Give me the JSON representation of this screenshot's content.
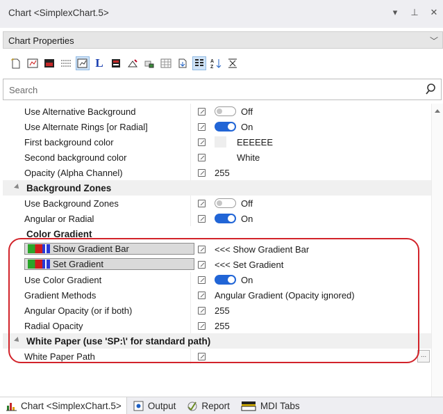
{
  "window": {
    "title": "Chart <SimplexChart.5>",
    "controls": [
      "dropdown-icon",
      "pin-icon",
      "close-icon"
    ]
  },
  "panel": {
    "header": "Chart Properties"
  },
  "search": {
    "placeholder": "Search"
  },
  "rows": [
    {
      "type": "prop",
      "label": "Use Alternative Background",
      "kind": "toggle",
      "state": "off",
      "value": "Off"
    },
    {
      "type": "prop",
      "label": "Use Alternate Rings [or Radial]",
      "kind": "toggle",
      "state": "on",
      "value": "On"
    },
    {
      "type": "prop",
      "label": "First background color",
      "kind": "color",
      "swatch": "#EEEEEE",
      "value": "EEEEEE"
    },
    {
      "type": "prop",
      "label": "Second background color",
      "kind": "color",
      "swatch": "#FFFFFF",
      "value": "White"
    },
    {
      "type": "prop",
      "label": "Opacity (Alpha Channel)",
      "kind": "text",
      "value": "255"
    },
    {
      "type": "category",
      "label": "Background Zones",
      "expanded": true
    },
    {
      "type": "prop",
      "label": "Use Background Zones",
      "kind": "toggle",
      "state": "off",
      "value": "Off"
    },
    {
      "type": "prop",
      "label": "Angular or Radial",
      "kind": "toggle",
      "state": "on",
      "value": "On"
    },
    {
      "type": "category",
      "label": "Color Gradient",
      "expanded": true
    },
    {
      "type": "prop",
      "label": "Show Gradient Bar",
      "kind": "button",
      "value": "<<< Show Gradient Bar"
    },
    {
      "type": "prop",
      "label": "Set Gradient",
      "kind": "button",
      "value": "<<< Set Gradient"
    },
    {
      "type": "prop",
      "label": "Use Color Gradient",
      "kind": "toggle",
      "state": "on",
      "value": "On"
    },
    {
      "type": "prop",
      "label": "Gradient Methods",
      "kind": "text",
      "value": "Angular Gradient (Opacity ignored)"
    },
    {
      "type": "prop",
      "label": "Angular Opacity (or if both)",
      "kind": "text",
      "value": "255"
    },
    {
      "type": "prop",
      "label": "Radial Opacity",
      "kind": "text",
      "value": "255"
    },
    {
      "type": "category",
      "label": "White Paper (use 'SP:\\' for standard path)",
      "expanded": true
    },
    {
      "type": "prop",
      "label": "White Paper Path",
      "kind": "path",
      "value": "",
      "button": "..."
    }
  ],
  "tabs": [
    {
      "label": "Chart <SimplexChart.5>",
      "icon": "chart-icon",
      "active": true
    },
    {
      "label": "Output",
      "icon": "output-icon",
      "active": false
    },
    {
      "label": "Report",
      "icon": "report-icon",
      "active": false
    },
    {
      "label": "MDI Tabs",
      "icon": "mdi-tabs-icon",
      "active": false
    }
  ],
  "colors": {
    "toggle_on": "#2165D6",
    "highlight": "#D2232A"
  }
}
